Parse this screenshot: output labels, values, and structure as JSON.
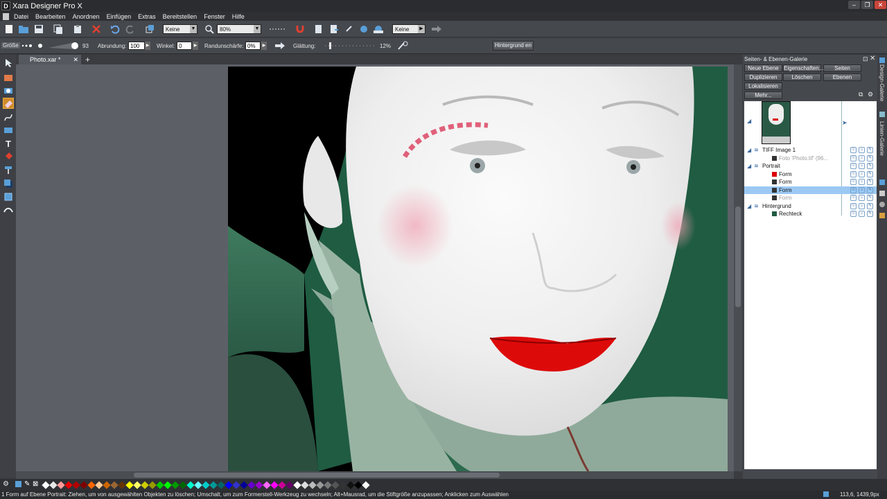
{
  "app": {
    "title": "Xara Designer Pro X",
    "logo_letter": "D"
  },
  "window_controls": [
    "–",
    "❐",
    "✕"
  ],
  "menu": [
    "Datei",
    "Bearbeiten",
    "Anordnen",
    "Einfügen",
    "Extras",
    "Bereitstellen",
    "Fenster",
    "Hilfe"
  ],
  "toolbar1": {
    "feather_combo": "Keine",
    "zoom_combo": "80%",
    "quality_combo": "Keine"
  },
  "toolbar2": {
    "size_label": "Größe",
    "size_value": "93",
    "rounding_label": "Abrundung:",
    "rounding_value": "100",
    "angle_label": "Winkel:",
    "angle_value": "0",
    "edge_label": "Randunschärfe:",
    "edge_value": "0%",
    "smoothing_label": "Glättung:",
    "smoothing_value": "12%",
    "background_button": "Hintergrund en"
  },
  "doc_tab": {
    "label": "Photo.xar *",
    "close": "✕",
    "add": "+"
  },
  "gallery": {
    "title": "Seiten- & Ebenen-Galerie",
    "buttons": {
      "new_layer": "Neue Ebene",
      "properties": "Eigenschaften...",
      "pages": "Seiten",
      "duplicate": "Duplizieren",
      "delete": "Löschen",
      "layers": "Ebenen",
      "locate": "Lokalisieren",
      "more": "Mehr..."
    },
    "layers": [
      {
        "name": "TIFF Image 1",
        "indent": 1,
        "type": "layer",
        "selected": false
      },
      {
        "name": "Foto 'Photo.tif' (96...",
        "indent": 3,
        "type": "object",
        "selected": false,
        "dim": true
      },
      {
        "name": "Portrait",
        "indent": 1,
        "type": "layer",
        "selected": false
      },
      {
        "name": "Form",
        "indent": 3,
        "type": "object",
        "selected": false
      },
      {
        "name": "Form",
        "indent": 3,
        "type": "object",
        "selected": false
      },
      {
        "name": "Form",
        "indent": 3,
        "type": "object",
        "selected": true
      },
      {
        "name": "Form",
        "indent": 3,
        "type": "object",
        "selected": false,
        "dim": true
      },
      {
        "name": "Hintergrund",
        "indent": 1,
        "type": "layer",
        "selected": false
      },
      {
        "name": "Rechteck",
        "indent": 3,
        "type": "object",
        "selected": false
      }
    ]
  },
  "right_strip": {
    "design_gallery": "Design-Galerie",
    "line_gallery": "Linien-Galerie"
  },
  "palette_colors": [
    "#ffffff",
    "#e8e8e8",
    "#ff9999",
    "#e60000",
    "#b30000",
    "#800000",
    "#ff6600",
    "#ffcc99",
    "#cc6600",
    "#996633",
    "#663300",
    "#ffff00",
    "#ffff66",
    "#cccc00",
    "#999900",
    "#00cc00",
    "#00ff00",
    "#009900",
    "#006600",
    "#00ffcc",
    "#66ffff",
    "#00cccc",
    "#009999",
    "#006666",
    "#0000ff",
    "#3333cc",
    "#000099",
    "#6600cc",
    "#9900cc",
    "#ff66ff",
    "#ff00ff",
    "#cc0099",
    "#660066",
    "#ffffff",
    "#dddddd",
    "#bbbbbb",
    "#999999",
    "#777777",
    "#555555",
    "#333333",
    "#111111",
    "#000000",
    "#ffffff"
  ],
  "status": {
    "message": "1 Form auf Ebene Portrait: Ziehen, um von ausgewählten Objekten zu löschen; Umschalt, um zum Formerstell-Werkzeug zu wechseln; Alt+Mausrad, um die Stiftgröße anzupassen; Anklicken zum Auswählen",
    "coords": "113,6, 1439,9px"
  }
}
